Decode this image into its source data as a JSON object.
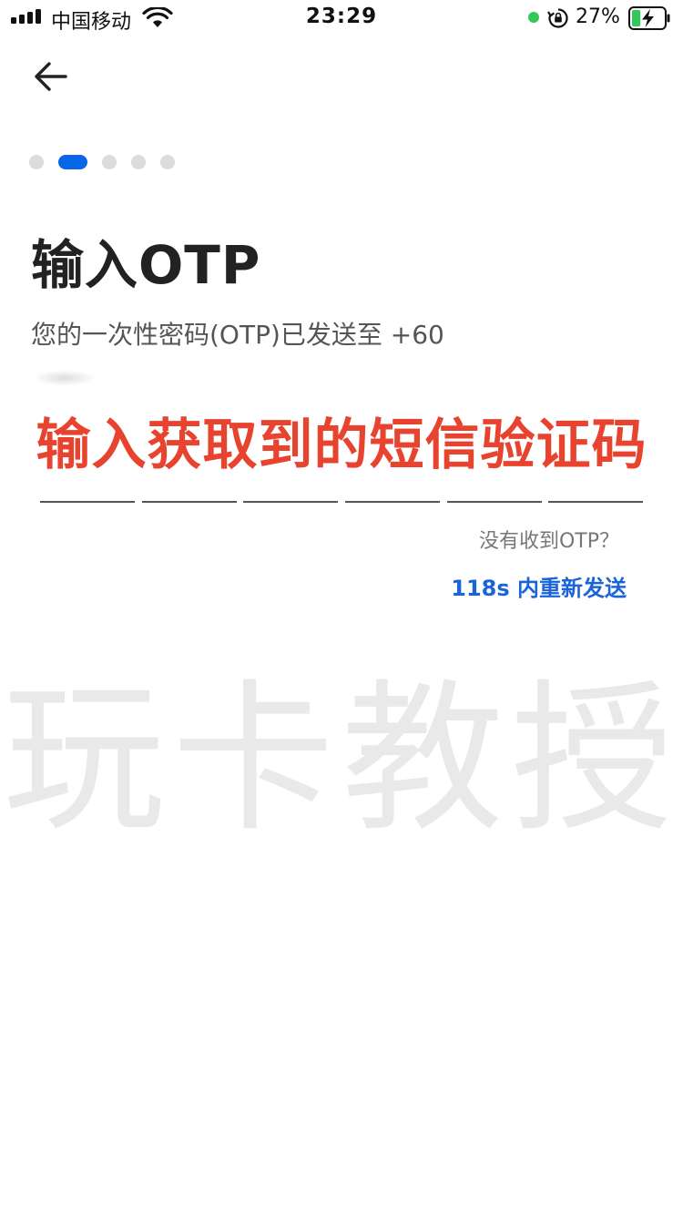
{
  "status_bar": {
    "carrier": "中国移动",
    "time": "23:29",
    "battery_percent": "27%",
    "icons": [
      "signal-icon",
      "wifi-icon",
      "privacy-indicator-icon",
      "rotation-lock-icon",
      "battery-charging-icon"
    ],
    "battery_level": 0.27
  },
  "header": {
    "back_icon": "arrow-left-icon"
  },
  "steps": {
    "count": 5,
    "active_index": 1,
    "active_color": "#0a66e8",
    "inactive_color": "#dcdcdc"
  },
  "main": {
    "title": "输入OTP",
    "subtitle": "您的一次性密码(OTP)已发送至 +60",
    "annotation": "输入获取到的短信验证码",
    "annotation_color": "#e8432f",
    "otp_cells": [
      "",
      "",
      "",
      "",
      "",
      ""
    ],
    "no_otp_text": "没有收到OTP？",
    "resend_text": "118s 内重新发送",
    "resend_color": "#1b64d8"
  },
  "watermark": {
    "text": "玩卡教授"
  }
}
